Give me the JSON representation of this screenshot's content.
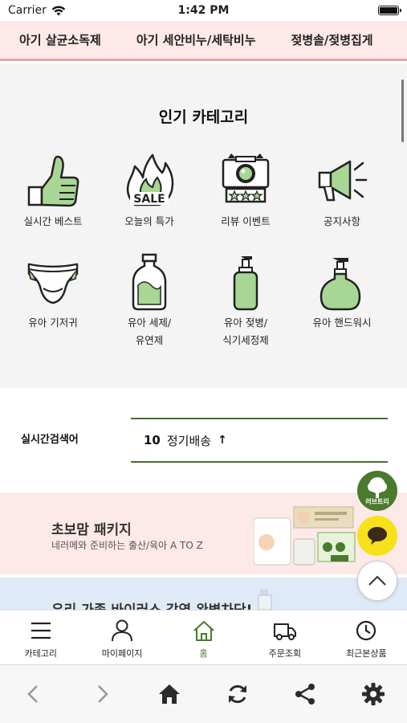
{
  "status_bar": {
    "carrier": "Carrier",
    "time": "1:42 PM"
  },
  "category_strip": [
    "아기 살균소독제",
    "아기 세안비누/세탁비누",
    "젖병솔/젖병집게"
  ],
  "popular": {
    "title": "인기 카테고리",
    "items": [
      {
        "label": "실시간 베스트",
        "icon": "thumbs-up-icon"
      },
      {
        "label": "오늘의 특가",
        "icon": "sale-flame-icon",
        "badge": "SALE"
      },
      {
        "label": "리뷰 이벤트",
        "icon": "camera-stars-icon"
      },
      {
        "label": "공지사항",
        "icon": "megaphone-icon"
      },
      {
        "label": "유아 기저귀",
        "icon": "diaper-icon"
      },
      {
        "label": "유아 세제/\n유연제",
        "icon": "detergent-bottle-icon"
      },
      {
        "label": "유아 젖병/\n식기세정제",
        "icon": "pump-bottle-icon"
      },
      {
        "label": "유아 핸드워시",
        "icon": "handwash-icon"
      }
    ]
  },
  "realtime_search": {
    "label": "실시간검색어",
    "rank": "10",
    "keyword": "정기배송",
    "trend": "↑"
  },
  "banners": [
    {
      "title": "초보맘 패키지",
      "subtitle": "네러메와 준비하는 출산/육아 A TO Z"
    },
    {
      "title": "우리 가족 바이러스 감염 완벽차단!"
    }
  ],
  "floating": {
    "lovetree_label": "러브트리"
  },
  "tabbar": [
    {
      "label": "카테고리",
      "icon": "hamburger-icon"
    },
    {
      "label": "마이페이지",
      "icon": "person-icon"
    },
    {
      "label": "홈",
      "icon": "home-outline-icon",
      "active": true
    },
    {
      "label": "주문조회",
      "icon": "truck-icon"
    },
    {
      "label": "최근본상품",
      "icon": "clock-icon"
    }
  ],
  "browser_bar": [
    "back-icon",
    "forward-icon",
    "home-icon",
    "refresh-icon",
    "share-icon",
    "settings-icon"
  ],
  "colors": {
    "brand_green": "#4a7a2b",
    "light_green": "#a8d694",
    "pink_bg": "#fde9e8",
    "kakao_yellow": "#f7e11a"
  }
}
